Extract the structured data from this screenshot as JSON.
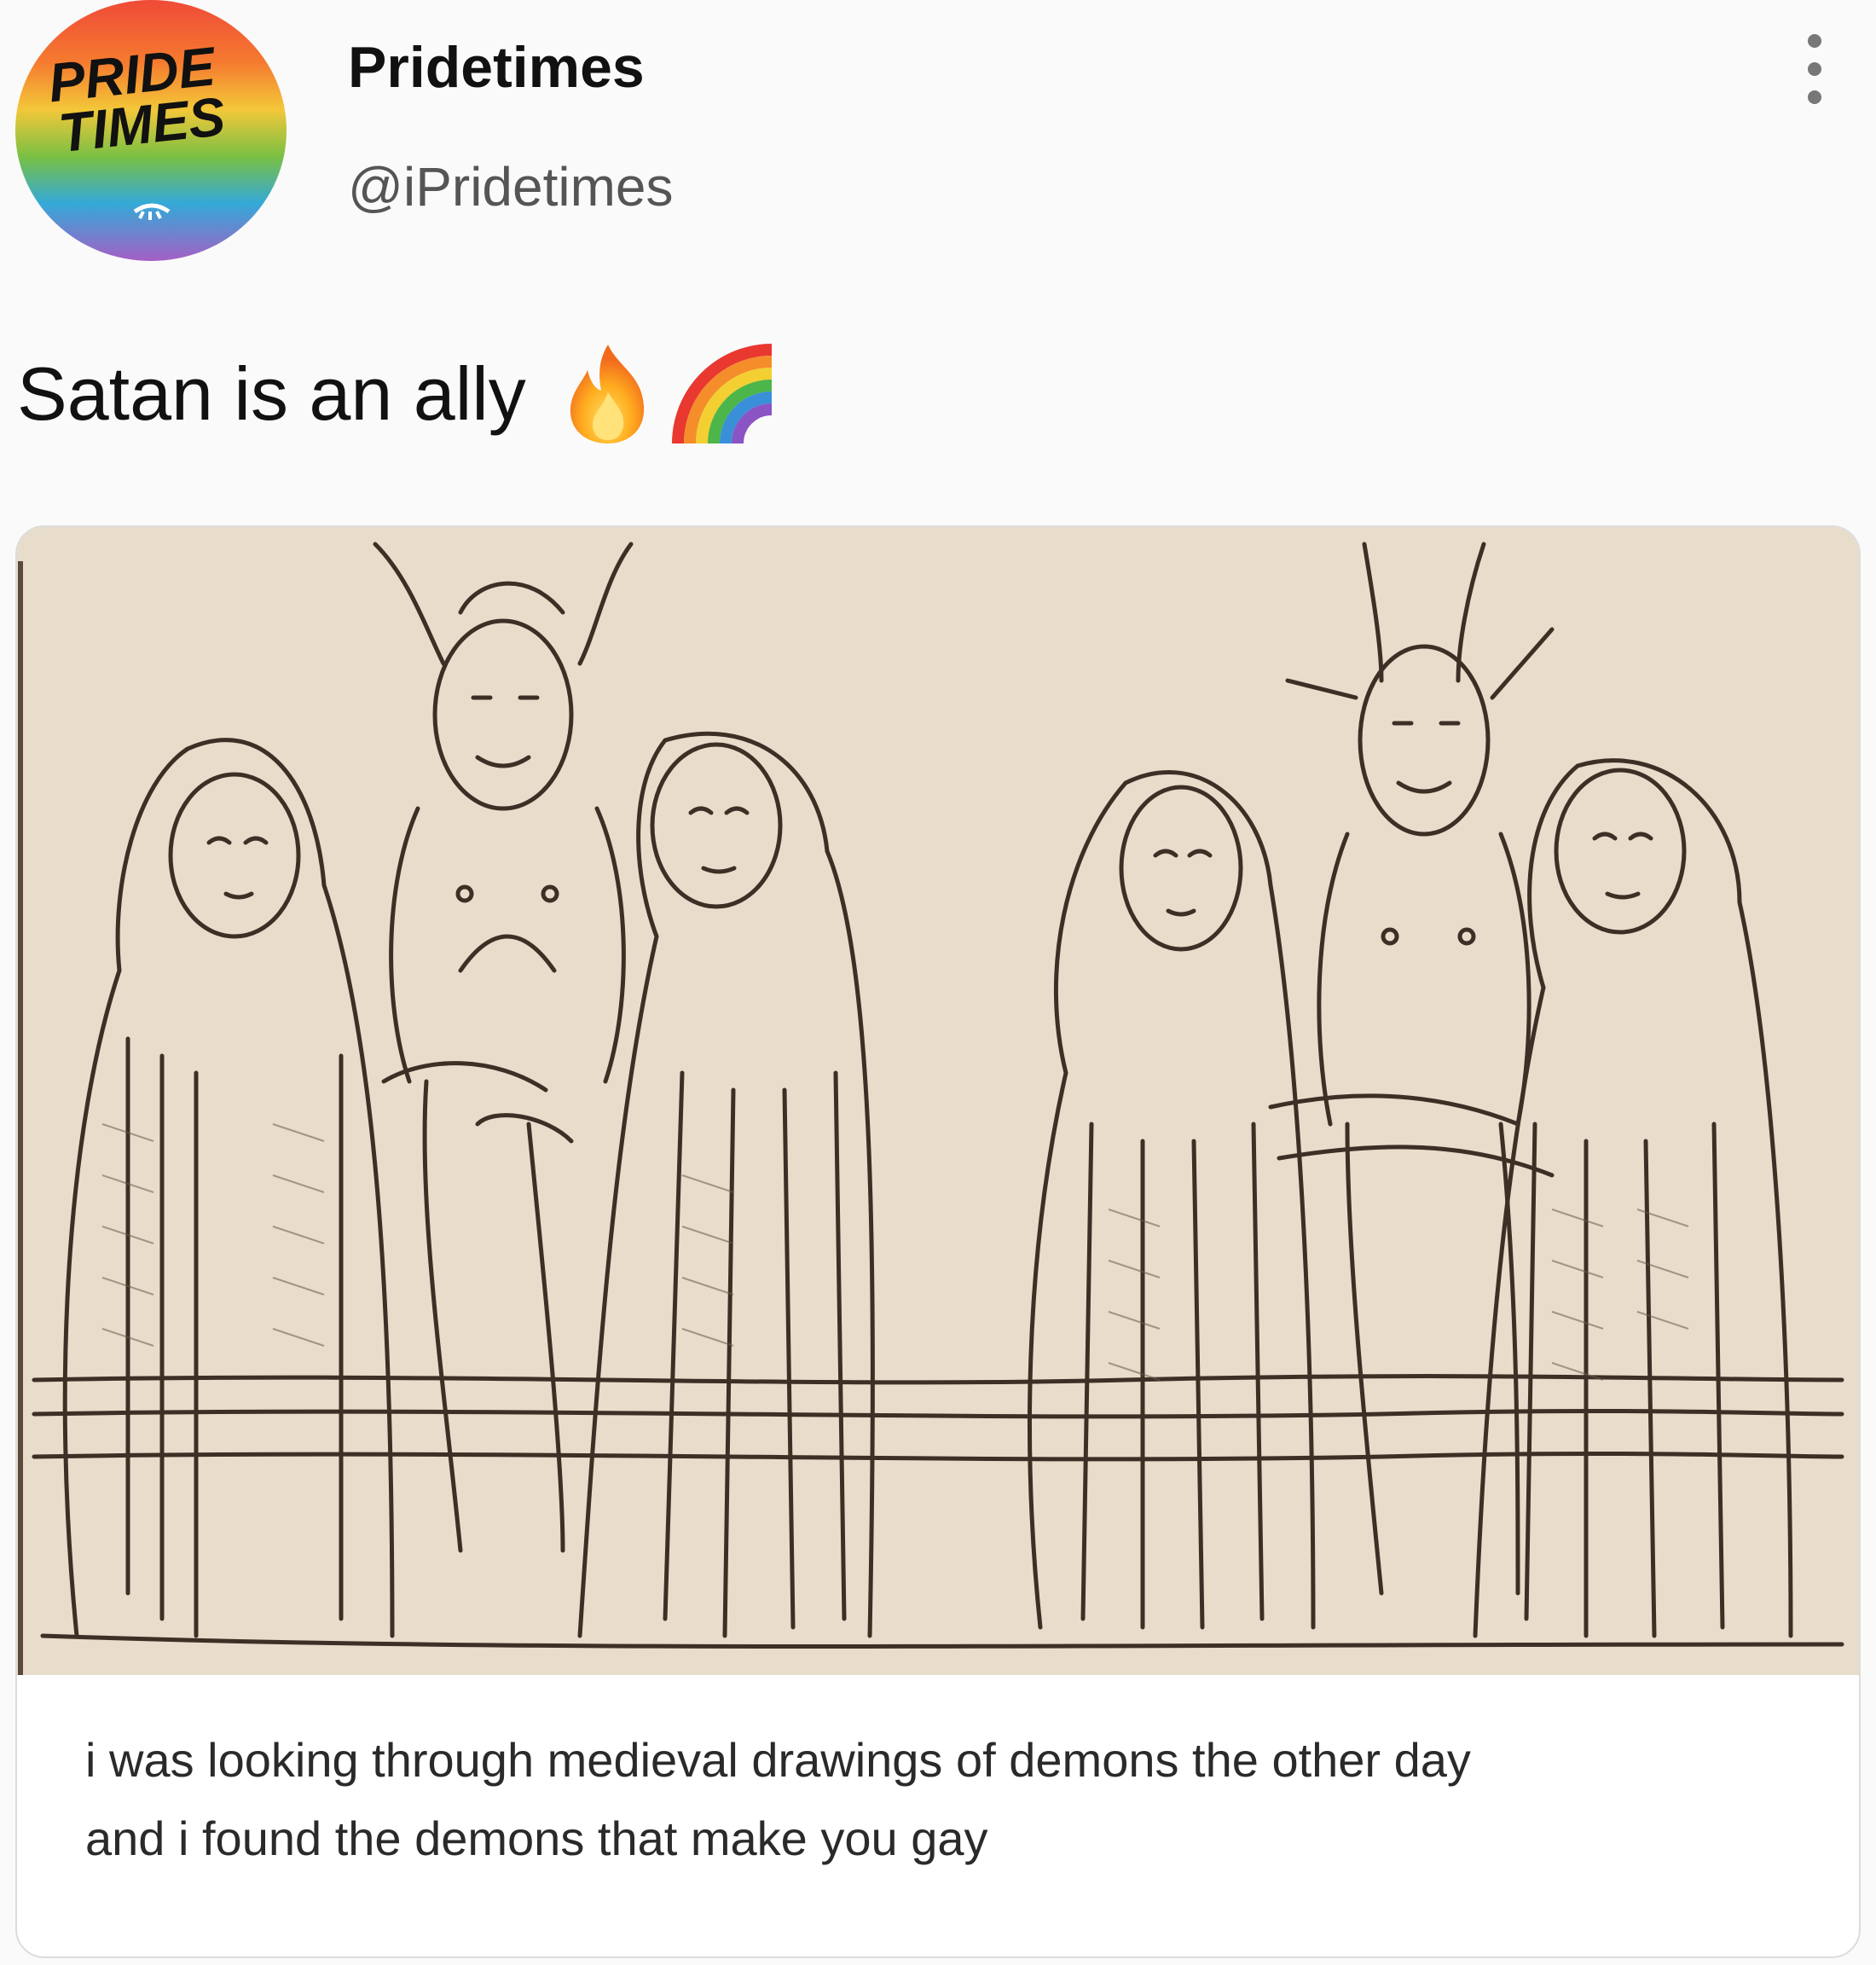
{
  "profile": {
    "display_name": "Pridetimes",
    "handle": "@iPridetimes",
    "avatar_text": [
      "PRIDE",
      "TIMES"
    ],
    "avatar_icon": "pride-times-logo"
  },
  "menu": {
    "icon": "more-vertical-icon"
  },
  "tweet": {
    "text": "Satan is an ally",
    "emojis": [
      "fire-icon",
      "rainbow-icon"
    ]
  },
  "card": {
    "image_icon": "medieval-woodcut-demons-illustration",
    "caption": [
      "i was looking through medieval drawings of demons the other day",
      "and i found the demons that make you gay"
    ]
  },
  "colors": {
    "background": "#fafafa",
    "text": "#111111",
    "handle": "#555555",
    "paper": "#e8dccb",
    "ink": "#3c3026"
  }
}
